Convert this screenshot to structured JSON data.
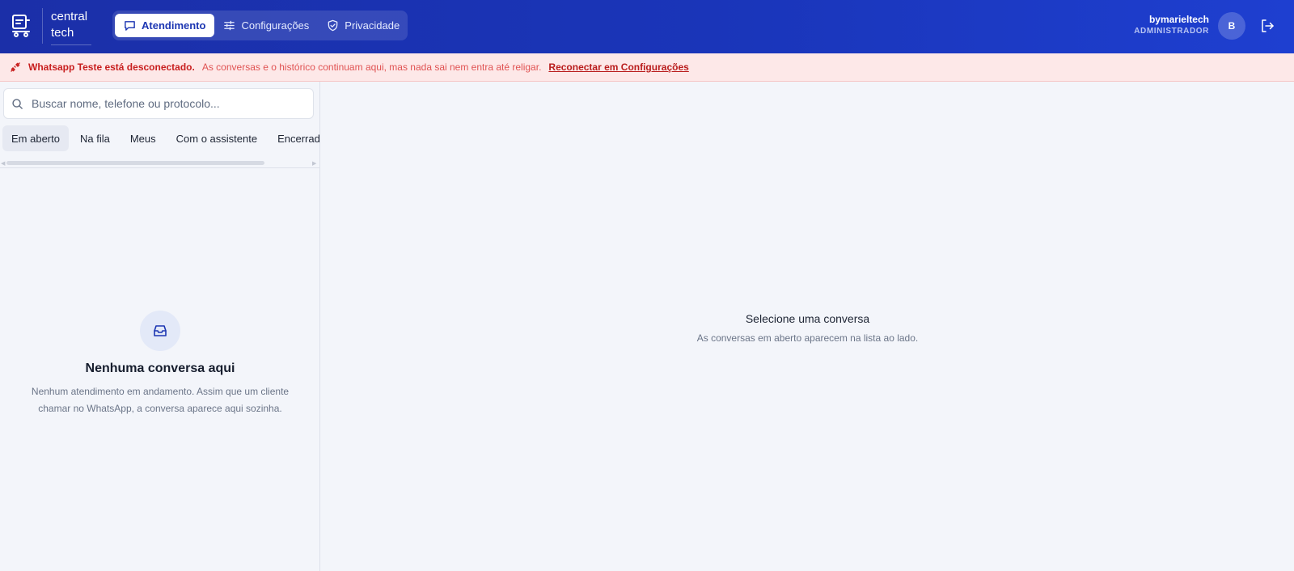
{
  "header": {
    "brand_line1": "central",
    "brand_line2": "tech",
    "nav": [
      {
        "label": "Atendimento",
        "icon": "chat-icon",
        "active": true
      },
      {
        "label": "Configurações",
        "icon": "sliders-icon",
        "active": false
      },
      {
        "label": "Privacidade",
        "icon": "shield-icon",
        "active": false
      }
    ],
    "user": {
      "name": "bymarieltech",
      "role": "ADMINISTRADOR",
      "initial": "B"
    }
  },
  "alert": {
    "title": "Whatsapp Teste está desconectado.",
    "message": "As conversas e o histórico continuam aqui, mas nada sai nem entra até religar.",
    "link": "Reconectar em Configurações"
  },
  "sidebar": {
    "search_placeholder": "Buscar nome, telefone ou protocolo...",
    "filters": [
      {
        "label": "Em aberto",
        "active": true
      },
      {
        "label": "Na fila",
        "active": false
      },
      {
        "label": "Meus",
        "active": false
      },
      {
        "label": "Com o assistente",
        "active": false
      },
      {
        "label": "Encerradas",
        "active": false
      }
    ],
    "empty": {
      "title": "Nenhuma conversa aqui",
      "text": "Nenhum atendimento em andamento. Assim que um cliente chamar no WhatsApp, a conversa aparece aqui sozinha."
    }
  },
  "main": {
    "title": "Selecione uma conversa",
    "subtitle": "As conversas em aberto aparecem na lista ao lado."
  },
  "colors": {
    "header": "#1a35b9",
    "alert_bg": "#fde8e8",
    "alert_text": "#c81e1e",
    "accent": "#1c36b2"
  }
}
